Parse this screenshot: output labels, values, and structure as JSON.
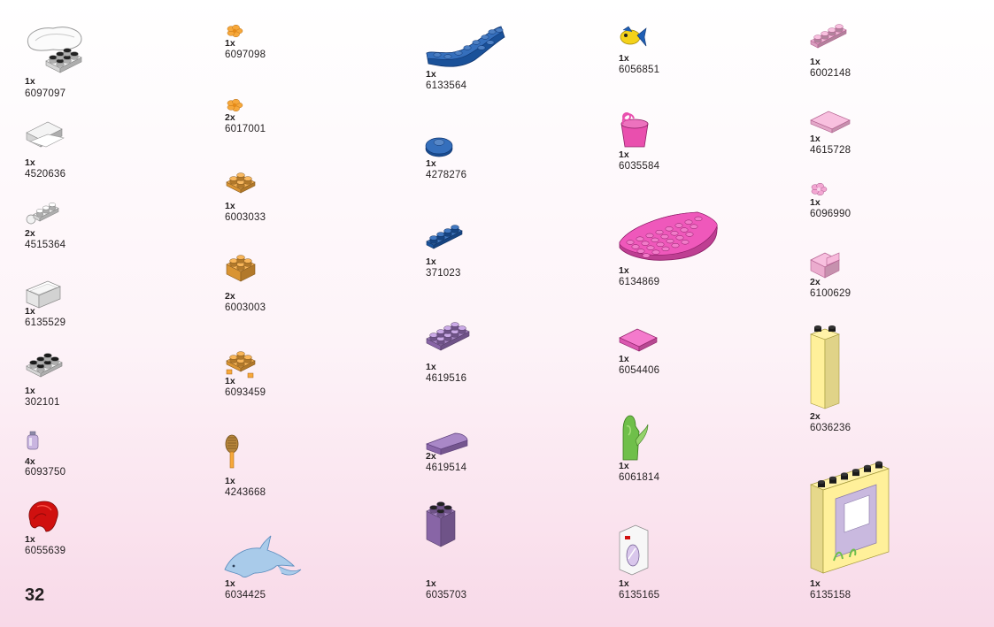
{
  "page_number": "32",
  "parts": [
    {
      "name": "part-6097097-shell-plate",
      "icon": "white-shell-plate-icon",
      "color": "#f2f2f2",
      "qty": "1x",
      "id": "6097097"
    },
    {
      "name": "part-4520636-white-drawer",
      "icon": "white-drawer-icon",
      "color": "#f2f2f2",
      "qty": "1x",
      "id": "4520636"
    },
    {
      "name": "part-4515364-white-bar-holder",
      "icon": "white-bar-holder-icon",
      "color": "#f2f2f2",
      "qty": "2x",
      "id": "4515364"
    },
    {
      "name": "part-6135529-white-box",
      "icon": "white-box-icon",
      "color": "#f2f2f2",
      "qty": "1x",
      "id": "6135529"
    },
    {
      "name": "part-302101-white-plate-2x3",
      "icon": "white-plate-icon",
      "color": "#f2f2f2",
      "qty": "1x",
      "id": "302101"
    },
    {
      "name": "part-6093750-lavender-bottle",
      "icon": "lavender-bottle-icon",
      "color": "#c9b5e0",
      "qty": "4x",
      "id": "6093750"
    },
    {
      "name": "part-6055639-red-hair",
      "icon": "red-hair-icon",
      "color": "#d0100f",
      "qty": "1x",
      "id": "6055639"
    },
    {
      "name": "part-6097098-orange-flower",
      "icon": "orange-flower-icon",
      "color": "#f7a83a",
      "qty": "1x",
      "id": "6097098"
    },
    {
      "name": "part-6017001-orange-flower",
      "icon": "orange-flower-icon",
      "color": "#f7a83a",
      "qty": "2x",
      "id": "6017001"
    },
    {
      "name": "part-6003033-orange-plate-2x2",
      "icon": "orange-plate-icon",
      "color": "#f7a83a",
      "qty": "1x",
      "id": "6003033"
    },
    {
      "name": "part-6003003-orange-brick-2x2",
      "icon": "orange-brick-icon",
      "color": "#f7a83a",
      "qty": "2x",
      "id": "6003003"
    },
    {
      "name": "part-6093459-orange-plate-clips",
      "icon": "orange-clip-plate-icon",
      "color": "#f7a83a",
      "qty": "1x",
      "id": "6093459"
    },
    {
      "name": "part-4243668-hairbrush",
      "icon": "hairbrush-icon",
      "color": "#b8863c",
      "qty": "1x",
      "id": "4243668"
    },
    {
      "name": "part-6034425-dolphin",
      "icon": "dolphin-icon",
      "color": "#a9cbea",
      "qty": "1x",
      "id": "6034425"
    },
    {
      "name": "part-6133564-blue-round-plate",
      "icon": "blue-quarter-round-plate-icon",
      "color": "#1f5fb4",
      "qty": "1x",
      "id": "6133564"
    },
    {
      "name": "part-4278276-blue-round-plate",
      "icon": "blue-round-plate-icon",
      "color": "#1f5fb4",
      "qty": "1x",
      "id": "4278276"
    },
    {
      "name": "part-371023-blue-plate-1x4",
      "icon": "blue-plate-icon",
      "color": "#1f5fb4",
      "qty": "1x",
      "id": "371023"
    },
    {
      "name": "part-4619516-purple-plate-2x4",
      "icon": "purple-plate-icon",
      "color": "#9a73bd",
      "qty": "1x",
      "id": "4619516"
    },
    {
      "name": "part-4619514-purple-curved-slope",
      "icon": "purple-slope-icon",
      "color": "#9a73bd",
      "qty": "2x",
      "id": "4619514"
    },
    {
      "name": "part-6035703-purple-box",
      "icon": "purple-box-icon",
      "color": "#9a73bd",
      "qty": "1x",
      "id": "6035703"
    },
    {
      "name": "part-6056851-yellow-fish",
      "icon": "yellow-fish-icon",
      "color": "#f4d21a",
      "qty": "1x",
      "id": "6056851"
    },
    {
      "name": "part-6035584-pink-bucket",
      "icon": "pink-bucket-icon",
      "color": "#e94fae",
      "qty": "1x",
      "id": "6035584"
    },
    {
      "name": "part-6134869-magenta-half-round-plate",
      "icon": "magenta-half-round-plate-icon",
      "color": "#ee4fb7",
      "qty": "1x",
      "id": "6134869"
    },
    {
      "name": "part-6054406-pink-tile-2x2",
      "icon": "pink-tile-icon",
      "color": "#f262c3",
      "qty": "1x",
      "id": "6054406"
    },
    {
      "name": "part-6061814-green-seaweed",
      "icon": "green-seaweed-icon",
      "color": "#6fbf4a",
      "qty": "1x",
      "id": "6061814"
    },
    {
      "name": "part-6135165-mirror-tile",
      "icon": "mirror-tile-icon",
      "color": "#f2f2f2",
      "qty": "1x",
      "id": "6135165"
    },
    {
      "name": "part-6002148-light-pink-plate-1x4",
      "icon": "light-pink-plate-icon",
      "color": "#f7b5d9",
      "qty": "1x",
      "id": "6002148"
    },
    {
      "name": "part-4615728-light-pink-tile",
      "icon": "light-pink-tile-icon",
      "color": "#f7b5d9",
      "qty": "1x",
      "id": "4615728"
    },
    {
      "name": "part-6096990-pink-flower",
      "icon": "pink-flower-icon",
      "color": "#f3a6d2",
      "qty": "1x",
      "id": "6096990"
    },
    {
      "name": "part-6100629-pink-chair",
      "icon": "pink-chair-icon",
      "color": "#f7b5d9",
      "qty": "2x",
      "id": "6100629"
    },
    {
      "name": "part-6036236-yellow-brick-1x2x5",
      "icon": "yellow-column-icon",
      "color": "#fff09a",
      "qty": "2x",
      "id": "6036236"
    },
    {
      "name": "part-6135158-yellow-window-panel",
      "icon": "yellow-window-panel-icon",
      "color": "#fff09a",
      "qty": "1x",
      "id": "6135158"
    }
  ]
}
